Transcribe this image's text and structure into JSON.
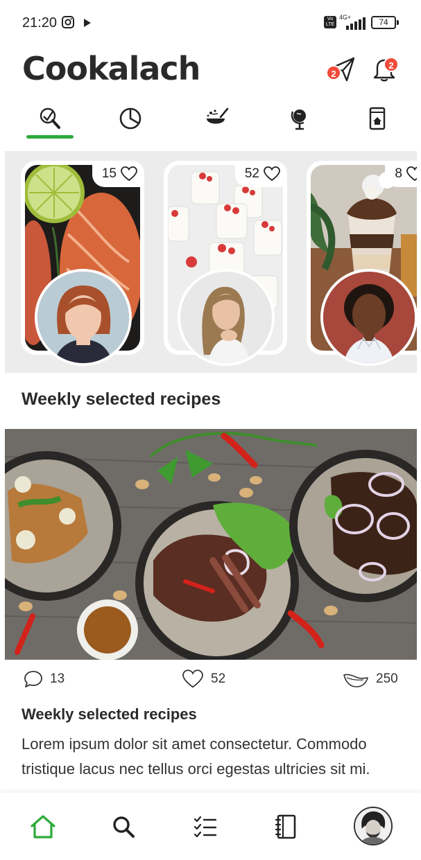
{
  "status_bar": {
    "time": "21:20",
    "network": "4G+",
    "volte": "Vo LTE",
    "battery": "74"
  },
  "header": {
    "title": "Cookalach",
    "send_badge": "2",
    "bell_badge": "2"
  },
  "tabs": [
    {
      "icon": "whisk-magnifier-icon",
      "active": true
    },
    {
      "icon": "pie-chart-icon",
      "active": false
    },
    {
      "icon": "cooking-pot-icon",
      "active": false
    },
    {
      "icon": "globe-icon",
      "active": false
    },
    {
      "icon": "recipe-book-icon",
      "active": false
    }
  ],
  "stories": [
    {
      "likes": "15",
      "photo": "salmon",
      "avatar": "woman-red-hair"
    },
    {
      "likes": "52",
      "photo": "dessert",
      "avatar": "woman-blonde"
    },
    {
      "likes": "8",
      "photo": "parfait",
      "avatar": "woman-dark-hair"
    }
  ],
  "section": {
    "title": "Weekly selected recipes"
  },
  "post": {
    "comments": "13",
    "likes": "52",
    "views": "250",
    "title": "Weekly selected recipes",
    "body": "Lorem ipsum dolor sit amet consectetur. Commodo tristique lacus nec tellus orci egestas ultricies sit mi."
  },
  "bottom_nav": [
    {
      "icon": "home-icon",
      "active": true
    },
    {
      "icon": "search-icon",
      "active": false
    },
    {
      "icon": "checklist-icon",
      "active": false
    },
    {
      "icon": "notebook-icon",
      "active": false
    },
    {
      "icon": "profile-avatar",
      "active": false
    }
  ],
  "colors": {
    "accent": "#2eaa3a",
    "badge": "#f04a3a",
    "text": "#2a2a2a",
    "stories_bg": "#ececec"
  }
}
